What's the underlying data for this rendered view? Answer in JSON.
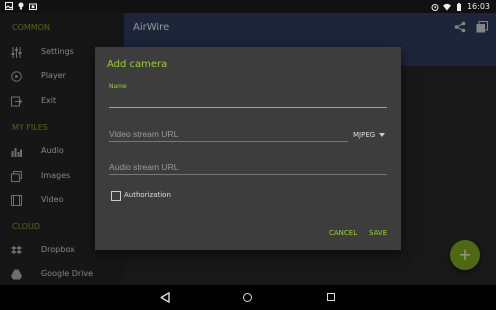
{
  "status_bar": {
    "time": "16:03"
  },
  "drawer": {
    "sections": [
      {
        "label": "COMMON",
        "items": [
          {
            "label": "Settings",
            "icon": "sliders-icon"
          },
          {
            "label": "Player",
            "icon": "play-icon"
          },
          {
            "label": "Exit",
            "icon": "exit-icon"
          }
        ]
      },
      {
        "label": "MY FILES",
        "items": [
          {
            "label": "Audio",
            "icon": "audio-icon"
          },
          {
            "label": "Images",
            "icon": "images-icon"
          },
          {
            "label": "Video",
            "icon": "video-icon"
          }
        ]
      },
      {
        "label": "CLOUD",
        "items": [
          {
            "label": "Dropbox",
            "icon": "dropbox-icon"
          },
          {
            "label": "Google Drive",
            "icon": "google-drive-icon"
          }
        ]
      }
    ]
  },
  "appbar": {
    "title": "AirWire"
  },
  "fab": {
    "label": "+"
  },
  "dialog": {
    "title": "Add camera",
    "name_label": "Name",
    "name_value": "",
    "video_placeholder": "Video stream URL",
    "format_selected": "MJPEG",
    "audio_placeholder": "Audio stream URL",
    "authorization_label": "Authorization",
    "authorization_checked": false,
    "cancel_label": "CANCEL",
    "save_label": "SAVE"
  },
  "colors": {
    "accent": "#9bd130",
    "appbar": "#2d3a5a",
    "dialog": "#3d3d3d"
  }
}
